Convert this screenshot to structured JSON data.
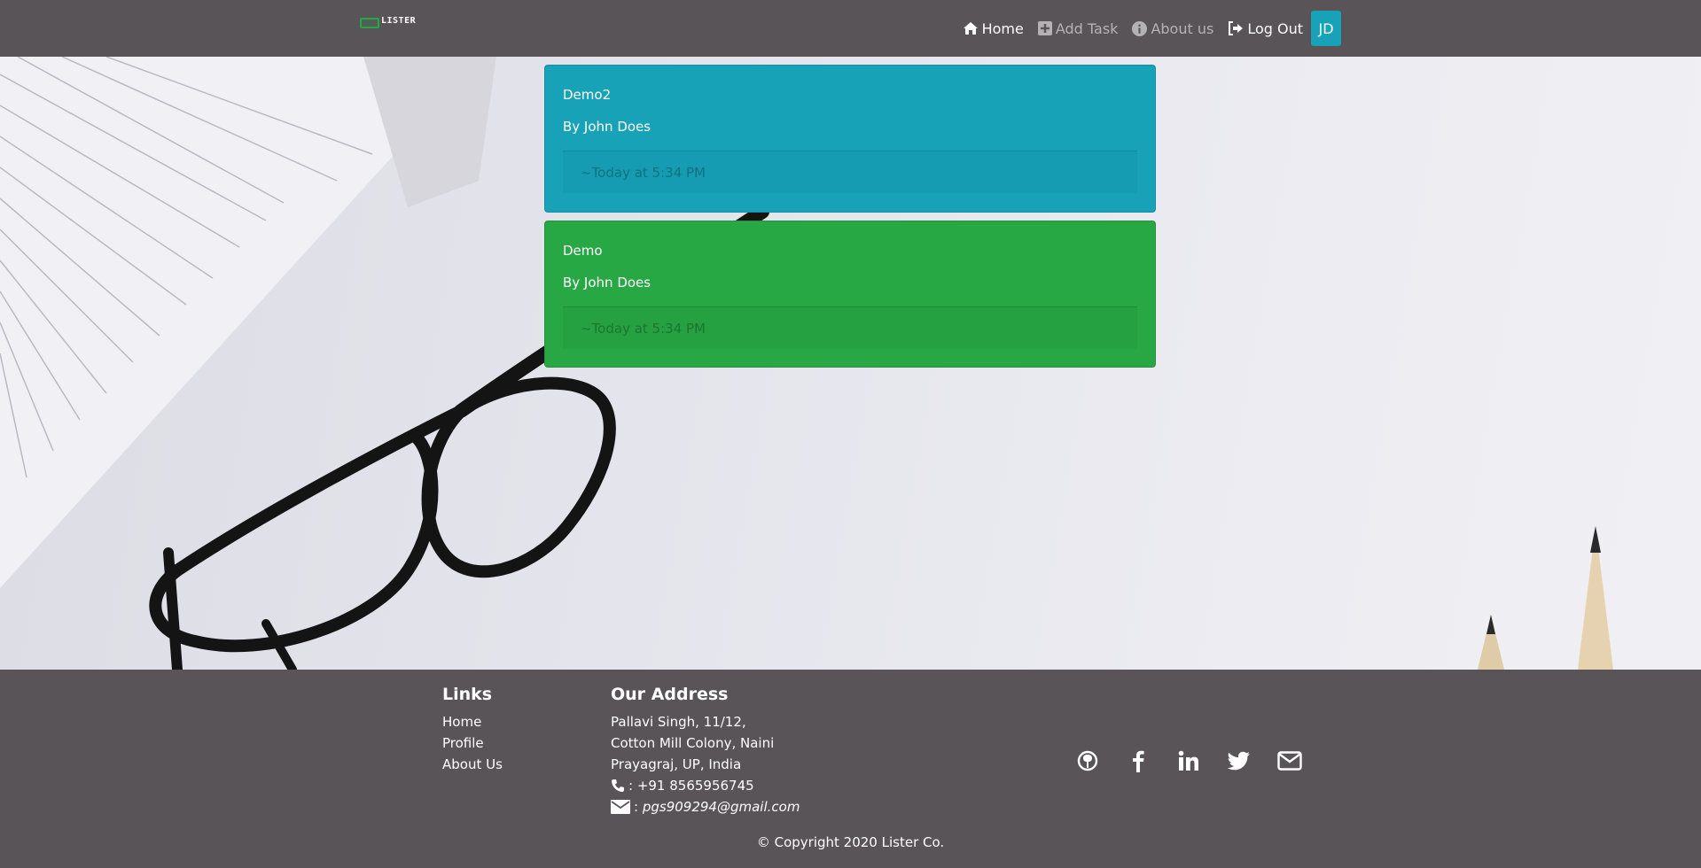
{
  "brand": {
    "name": "LISTER"
  },
  "nav": {
    "home": "Home",
    "add_task": "Add Task",
    "about": "About us",
    "logout": "Log Out",
    "avatar": "JD"
  },
  "tasks": [
    {
      "title": "Demo2",
      "author": "By John Does",
      "time": "~Today at 5:34 PM",
      "color": "#17a2b8"
    },
    {
      "title": "Demo",
      "author": "By John Does",
      "time": "~Today at 5:34 PM",
      "color": "#28a745"
    }
  ],
  "footer": {
    "links_heading": "Links",
    "links": [
      "Home",
      "Profile",
      "About Us"
    ],
    "address_heading": "Our Address",
    "address_lines": [
      "Pallavi Singh, 11/12,",
      "Cotton Mill Colony, Naini",
      "Prayagraj, UP, India"
    ],
    "phone": ": +91 8565956745",
    "email_prefix": ":",
    "email": "pgs909294@gmail.com",
    "copyright": "© Copyright 2020 Lister Co."
  },
  "social_icons": [
    "github-icon",
    "facebook-icon",
    "linkedin-icon",
    "twitter-icon",
    "envelope-icon"
  ]
}
